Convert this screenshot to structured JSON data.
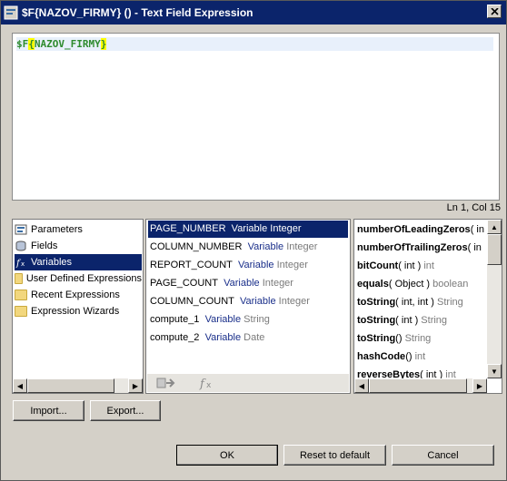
{
  "window": {
    "title": "$F{NAZOV_FIRMY} () - Text Field Expression"
  },
  "editor": {
    "prefix": "$F",
    "brace_open": "{",
    "field_name": "NAZOV_FIRMY",
    "brace_close": "}"
  },
  "status": "Ln 1, Col 15",
  "categories": [
    {
      "label": "Parameters",
      "icon": "parameters-icon"
    },
    {
      "label": "Fields",
      "icon": "database-icon"
    },
    {
      "label": "Variables",
      "icon": "function-icon"
    },
    {
      "label": "User Defined Expressions",
      "icon": "folder-icon"
    },
    {
      "label": "Recent Expressions",
      "icon": "folder-icon"
    },
    {
      "label": "Expression Wizards",
      "icon": "folder-icon"
    }
  ],
  "variables": [
    {
      "name": "PAGE_NUMBER",
      "kind": "Variable",
      "type": "Integer"
    },
    {
      "name": "COLUMN_NUMBER",
      "kind": "Variable",
      "type": "Integer"
    },
    {
      "name": "REPORT_COUNT",
      "kind": "Variable",
      "type": "Integer"
    },
    {
      "name": "PAGE_COUNT",
      "kind": "Variable",
      "type": "Integer"
    },
    {
      "name": "COLUMN_COUNT",
      "kind": "Variable",
      "type": "Integer"
    },
    {
      "name": "compute_1",
      "kind": "Variable",
      "type": "String"
    },
    {
      "name": "compute_2",
      "kind": "Variable",
      "type": "Date"
    }
  ],
  "methods": [
    {
      "name": "numberOfLeadingZeros",
      "args": "( in",
      "ret": ""
    },
    {
      "name": "numberOfTrailingZeros",
      "args": "( in",
      "ret": ""
    },
    {
      "name": "bitCount",
      "args": "( int )",
      "ret": "int"
    },
    {
      "name": "equals",
      "args": "( Object )",
      "ret": "boolean"
    },
    {
      "name": "toString",
      "args": "( int, int )",
      "ret": "String"
    },
    {
      "name": "toString",
      "args": "( int )",
      "ret": "String"
    },
    {
      "name": "toString",
      "args": "()",
      "ret": "String"
    },
    {
      "name": "hashCode",
      "args": "()",
      "ret": "int"
    },
    {
      "name": "reverseBytes",
      "args": "( int )",
      "ret": "int"
    }
  ],
  "buttons": {
    "import": "Import...",
    "export": "Export...",
    "ok": "OK",
    "reset": "Reset to default",
    "cancel": "Cancel"
  },
  "colors": {
    "titlebar": "#0b246b",
    "selection": "#0b246b",
    "code_green": "#2e8b2e",
    "brace_highlight": "#ffff00"
  }
}
